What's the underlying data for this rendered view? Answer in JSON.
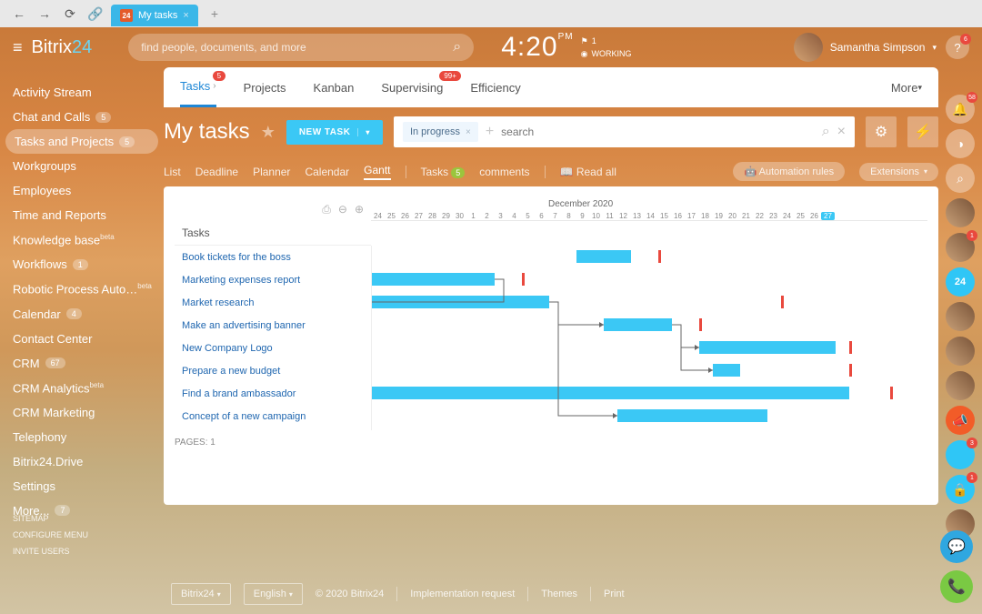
{
  "browser": {
    "tab_title": "My tasks"
  },
  "brand": {
    "name": "Bitrix",
    "suffix": "24"
  },
  "search": {
    "placeholder": "find people, documents, and more"
  },
  "clock": {
    "time": "4:20",
    "ampm": "PM",
    "flag": "1",
    "status": "WORKING"
  },
  "user": {
    "name": "Samantha Simpson"
  },
  "help_badge": "6",
  "sidebar": {
    "items": [
      {
        "label": "Activity Stream"
      },
      {
        "label": "Chat and Calls",
        "badge": "5"
      },
      {
        "label": "Tasks and Projects",
        "badge": "5",
        "active": true
      },
      {
        "label": "Workgroups"
      },
      {
        "label": "Employees"
      },
      {
        "label": "Time and Reports"
      },
      {
        "label": "Knowledge base",
        "sup": "beta"
      },
      {
        "label": "Workflows",
        "badge": "1"
      },
      {
        "label": "Robotic Process Auto…",
        "sup": "beta"
      },
      {
        "label": "Calendar",
        "badge": "4"
      },
      {
        "label": "Contact Center"
      },
      {
        "label": "CRM",
        "badge": "67"
      },
      {
        "label": "CRM Analytics",
        "sup": "beta"
      },
      {
        "label": "CRM Marketing"
      },
      {
        "label": "Telephony"
      },
      {
        "label": "Bitrix24.Drive"
      },
      {
        "label": "Settings"
      },
      {
        "label": "More... ",
        "badge": "7"
      }
    ],
    "footer": [
      "SITEMAP",
      "CONFIGURE MENU",
      "INVITE USERS"
    ]
  },
  "tabs": [
    {
      "label": "Tasks",
      "badge": "5",
      "active": true,
      "chev": true
    },
    {
      "label": "Projects"
    },
    {
      "label": "Kanban"
    },
    {
      "label": "Supervising",
      "badge": "99+"
    },
    {
      "label": "Efficiency"
    }
  ],
  "tabs_more": "More",
  "page_title": "My tasks",
  "new_task_btn": "NEW TASK",
  "filter": {
    "chip": "In progress",
    "placeholder": "search"
  },
  "views": {
    "list": [
      "List",
      "Deadline",
      "Planner",
      "Calendar",
      "Gantt"
    ],
    "active": 4,
    "tasks_label": "Tasks",
    "tasks_count": "5",
    "comments": "comments",
    "read_all": "Read all",
    "automation": "Automation rules",
    "extensions": "Extensions"
  },
  "gantt": {
    "month": "December 2020",
    "tasks_header": "Tasks",
    "days": [
      24,
      25,
      26,
      27,
      28,
      29,
      30,
      1,
      2,
      3,
      4,
      5,
      6,
      7,
      8,
      9,
      10,
      11,
      12,
      13,
      14,
      15,
      16,
      17,
      18,
      19,
      20,
      21,
      22,
      23,
      24,
      25,
      26,
      27
    ],
    "today_index": 33
  },
  "chart_data": {
    "type": "gantt",
    "x_unit": "day",
    "x_start": "2020-11-24",
    "x_end": "2020-12-27",
    "rows": [
      {
        "name": "Book tickets for the boss",
        "bars": [
          {
            "start": 15,
            "end": 19
          }
        ],
        "deadline": 21
      },
      {
        "name": "Marketing expenses report",
        "bars": [
          {
            "start": 0,
            "end": 9
          }
        ],
        "deadline": 11
      },
      {
        "name": "Market research",
        "bars": [
          {
            "start": 0,
            "end": 13
          }
        ],
        "deadline": 30
      },
      {
        "name": "Make an advertising banner",
        "bars": [
          {
            "start": 17,
            "end": 22
          }
        ],
        "deadline": 24
      },
      {
        "name": "New Company Logo",
        "bars": [
          {
            "start": 24,
            "end": 34
          }
        ],
        "deadline": 35
      },
      {
        "name": "Prepare a new budget",
        "bars": [
          {
            "start": 25,
            "end": 27
          }
        ],
        "deadline": 35
      },
      {
        "name": "Find a brand ambassador",
        "bars": [
          {
            "start": 0,
            "end": 35
          }
        ],
        "deadline": 38
      },
      {
        "name": "Concept of a new campaign",
        "bars": [
          {
            "start": 18,
            "end": 29
          }
        ]
      }
    ],
    "dependencies": [
      {
        "from": 1,
        "to": 2
      },
      {
        "from": 2,
        "to": 3
      },
      {
        "from": 2,
        "to": 7
      },
      {
        "from": 3,
        "to": 4
      },
      {
        "from": 3,
        "to": 5
      }
    ]
  },
  "pages": {
    "label": "PAGES:",
    "value": "1"
  },
  "rail_bell": "58",
  "footer": {
    "brand": "Bitrix24",
    "lang": "English",
    "copyright": "© 2020 Bitrix24",
    "links": [
      "Implementation request",
      "Themes",
      "Print"
    ]
  }
}
